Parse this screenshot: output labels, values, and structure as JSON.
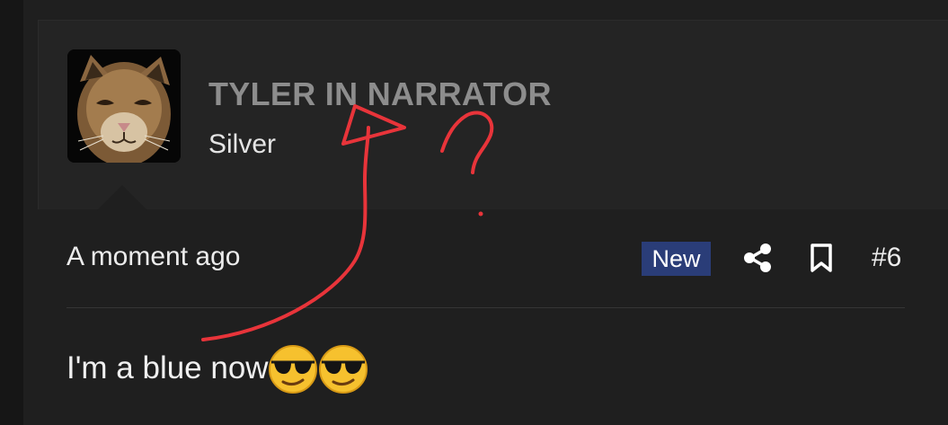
{
  "post": {
    "username": "TYLER IN NARRATOR",
    "user_title": "Silver",
    "timestamp": "A moment ago",
    "badge": "New",
    "post_number": "#6",
    "message": "I'm a blue now",
    "emoji": [
      "smiling-face-with-sunglasses",
      "smiling-face-with-sunglasses"
    ]
  },
  "annotation": {
    "color": "#e8343a",
    "marks": [
      "arrow",
      "question-mark"
    ]
  },
  "icons": {
    "share": "share-icon",
    "bookmark": "bookmark-icon"
  },
  "colors": {
    "background": "#1f1f1f",
    "username": "#8d8d8d",
    "badge": "#2a3d78"
  }
}
